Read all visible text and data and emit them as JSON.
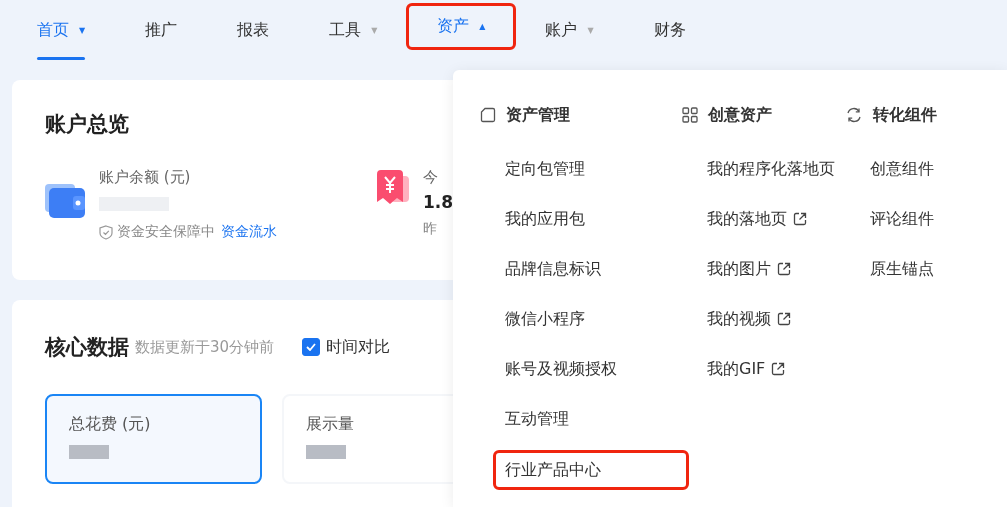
{
  "nav": [
    {
      "label": "首页",
      "caret": "▼",
      "selected": true,
      "highlighted": false
    },
    {
      "label": "推广",
      "selected": false,
      "highlighted": false
    },
    {
      "label": "报表",
      "selected": false,
      "highlighted": false
    },
    {
      "label": "工具",
      "caret": "▼",
      "selected": false,
      "highlighted": false
    },
    {
      "label": "资产",
      "caret": "▲",
      "selected": false,
      "highlighted": true
    },
    {
      "label": "账户",
      "caret": "▼",
      "selected": false,
      "highlighted": false
    },
    {
      "label": "财务",
      "selected": false,
      "highlighted": false
    }
  ],
  "account_overview": {
    "title": "账户总览",
    "balance_label": "账户余额 (元)",
    "safety_note": "资金安全保障中",
    "flow_link": "资金流水",
    "today_label": "今",
    "today_value": "1.8",
    "yesterday_label": "昨"
  },
  "core_data": {
    "title": "核心数据",
    "subtitle": "数据更新于30分钟前",
    "compare": {
      "label": "时间对比",
      "checked": true
    },
    "metrics": [
      {
        "label": "总花费 (元)",
        "selected": true
      },
      {
        "label": "展示量",
        "selected": false
      }
    ]
  },
  "asset_menu": {
    "columns": [
      {
        "title": "资产管理",
        "items": [
          {
            "label": "定向包管理",
            "external": false,
            "highlighted": false
          },
          {
            "label": "我的应用包",
            "external": false,
            "highlighted": false
          },
          {
            "label": "品牌信息标识",
            "external": false,
            "highlighted": false
          },
          {
            "label": "微信小程序",
            "external": false,
            "highlighted": false
          },
          {
            "label": "账号及视频授权",
            "external": false,
            "highlighted": false
          },
          {
            "label": "互动管理",
            "external": false,
            "highlighted": false
          },
          {
            "label": "行业产品中心",
            "external": false,
            "highlighted": true
          }
        ]
      },
      {
        "title": "创意资产",
        "items": [
          {
            "label": "我的程序化落地页",
            "external": false,
            "highlighted": false
          },
          {
            "label": "我的落地页",
            "external": true,
            "highlighted": false
          },
          {
            "label": "我的图片",
            "external": true,
            "highlighted": false
          },
          {
            "label": "我的视频",
            "external": true,
            "highlighted": false
          },
          {
            "label": "我的GIF",
            "external": true,
            "highlighted": false
          }
        ]
      },
      {
        "title": "转化组件",
        "items": [
          {
            "label": "创意组件",
            "external": false,
            "highlighted": false
          },
          {
            "label": "评论组件",
            "external": false,
            "highlighted": false
          },
          {
            "label": "原生锚点",
            "external": false,
            "highlighted": false
          }
        ]
      }
    ]
  }
}
